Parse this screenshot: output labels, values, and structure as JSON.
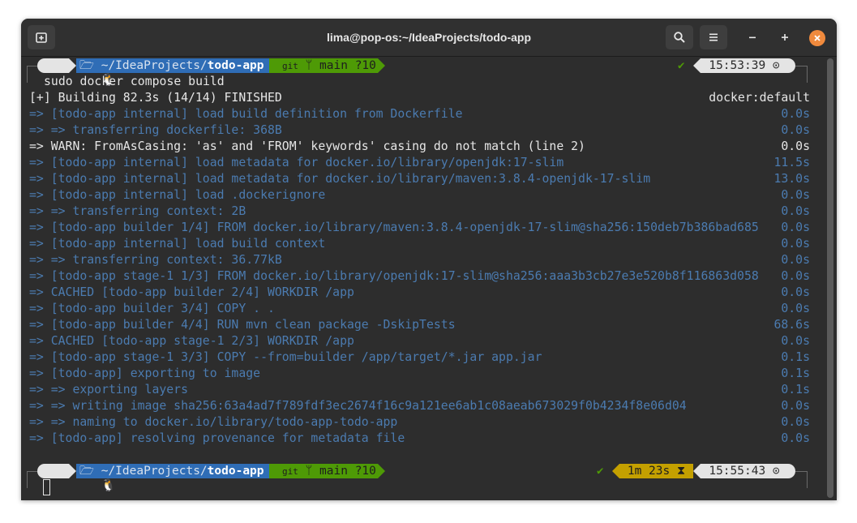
{
  "window": {
    "title": "lima@pop-os:~/IdeaProjects/todo-app"
  },
  "prompt1": {
    "os_glyph": "🐧",
    "folder_glyph": "🗁",
    "dir_prefix": "~/IdeaProjects/",
    "dir_name": "todo-app",
    "git_glyph": "git",
    "branch_glyph": "ᛘ",
    "branch": "main ?10",
    "check": "✔",
    "time": "15:53:39",
    "clock_glyph": "⊙"
  },
  "command": "sudo docker compose build",
  "build_header": {
    "text": "[+] Building 82.3s (14/14) FINISHED",
    "right": "docker:default"
  },
  "log": [
    {
      "text": "=> [todo-app internal] load build definition from Dockerfile",
      "time": "0.0s",
      "style": "blue"
    },
    {
      "text": "=> => transferring dockerfile: 368B",
      "time": "0.0s",
      "style": "blue"
    },
    {
      "text": "=> WARN: FromAsCasing: 'as' and 'FROM' keywords' casing do not match (line 2)",
      "time": "0.0s",
      "style": "white"
    },
    {
      "text": "=> [todo-app internal] load metadata for docker.io/library/openjdk:17-slim",
      "time": "11.5s",
      "style": "blue"
    },
    {
      "text": "=> [todo-app internal] load metadata for docker.io/library/maven:3.8.4-openjdk-17-slim",
      "time": "13.0s",
      "style": "blue"
    },
    {
      "text": "=> [todo-app internal] load .dockerignore",
      "time": "0.0s",
      "style": "blue"
    },
    {
      "text": "=> => transferring context: 2B",
      "time": "0.0s",
      "style": "blue"
    },
    {
      "text": "=> [todo-app builder 1/4] FROM docker.io/library/maven:3.8.4-openjdk-17-slim@sha256:150deb7b386bad685",
      "time": "0.0s",
      "style": "blue"
    },
    {
      "text": "=> [todo-app internal] load build context",
      "time": "0.0s",
      "style": "blue"
    },
    {
      "text": "=> => transferring context: 36.77kB",
      "time": "0.0s",
      "style": "blue"
    },
    {
      "text": "=> [todo-app stage-1 1/3] FROM docker.io/library/openjdk:17-slim@sha256:aaa3b3cb27e3e520b8f116863d058",
      "time": "0.0s",
      "style": "blue"
    },
    {
      "text": "=> CACHED [todo-app builder 2/4] WORKDIR /app",
      "time": "0.0s",
      "style": "blue"
    },
    {
      "text": "=> [todo-app builder 3/4] COPY . .",
      "time": "0.0s",
      "style": "blue"
    },
    {
      "text": "=> [todo-app builder 4/4] RUN mvn clean package -DskipTests",
      "time": "68.6s",
      "style": "blue"
    },
    {
      "text": "=> CACHED [todo-app stage-1 2/3] WORKDIR /app",
      "time": "0.0s",
      "style": "blue"
    },
    {
      "text": "=> [todo-app stage-1 3/3] COPY --from=builder /app/target/*.jar app.jar",
      "time": "0.1s",
      "style": "blue"
    },
    {
      "text": "=> [todo-app] exporting to image",
      "time": "0.1s",
      "style": "blue"
    },
    {
      "text": "=> => exporting layers",
      "time": "0.1s",
      "style": "blue"
    },
    {
      "text": "=> => writing image sha256:63a4ad7f789fdf3ec2674f16c9a121ee6ab1c08aeab673029f0b4234f8e06d04",
      "time": "0.0s",
      "style": "blue"
    },
    {
      "text": "=> => naming to docker.io/library/todo-app-todo-app",
      "time": "0.0s",
      "style": "blue"
    },
    {
      "text": "=> [todo-app] resolving provenance for metadata file",
      "time": "0.0s",
      "style": "blue"
    }
  ],
  "prompt2": {
    "os_glyph": "🐧",
    "folder_glyph": "🗁",
    "dir_prefix": "~/IdeaProjects/",
    "dir_name": "todo-app",
    "git_glyph": "git",
    "branch_glyph": "ᛘ",
    "branch": "main ?10",
    "check": "✔",
    "duration": "1m 23s",
    "hourglass_glyph": "⧗",
    "time": "15:55:43",
    "clock_glyph": "⊙"
  },
  "icons": {
    "new_tab": "new-tab-icon",
    "search": "search-icon",
    "menu": "hamburger-menu-icon",
    "minimize": "minimize-icon",
    "maximize": "maximize-icon",
    "close": "close-icon"
  },
  "colors": {
    "terminal_bg": "#2d2d2d",
    "log_blue": "#4b7bb0",
    "dir_segment": "#2f6db6",
    "git_segment": "#4e9a06",
    "duration_segment": "#c4a000",
    "close_button": "#f08a3d"
  }
}
